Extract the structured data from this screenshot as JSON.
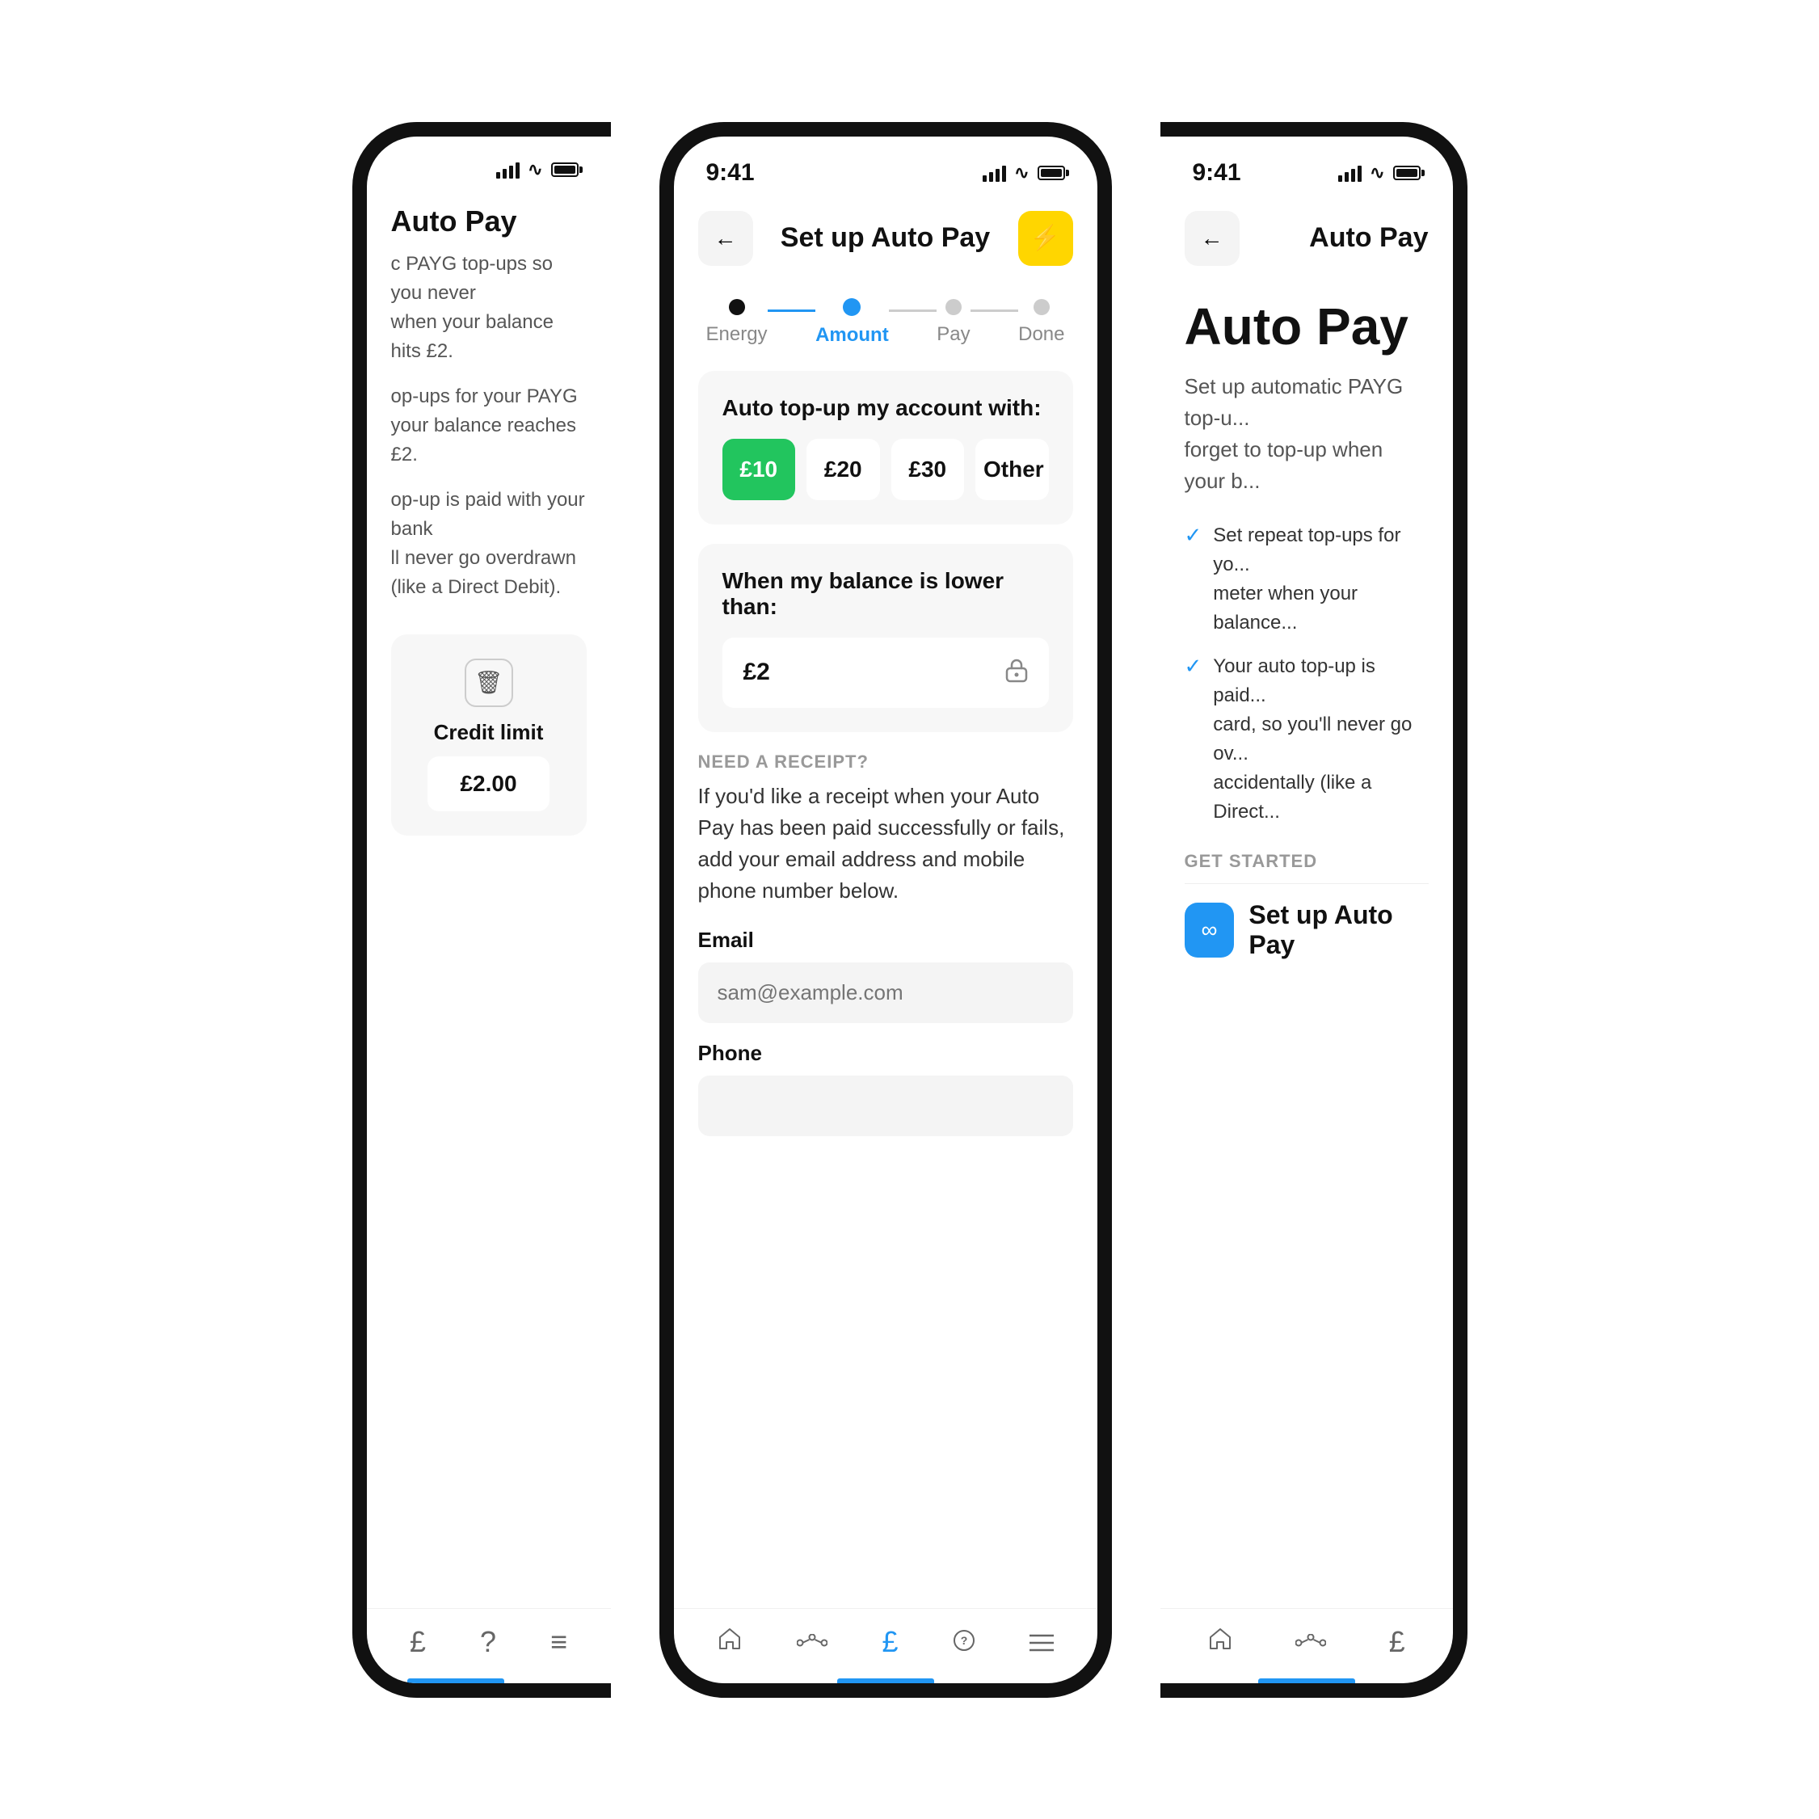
{
  "left_phone": {
    "title": "Auto Pay",
    "desc1": "c PAYG top-ups so you never\nwhen your balance hits £2.",
    "desc2": "op-ups for your PAYG\nyour balance reaches £2.",
    "desc3": "op-up is paid with your bank\nll never go overdrawn\n(like a Direct Debit).",
    "credit_limit_label": "Credit limit",
    "credit_amount": "£2.00",
    "bottom_nav": [
      "£",
      "?",
      "≡"
    ]
  },
  "center_phone": {
    "time": "9:41",
    "back_label": "←",
    "title": "Set up Auto Pay",
    "lightning": "⚡",
    "steps": [
      {
        "label": "Energy",
        "state": "completed"
      },
      {
        "label": "Amount",
        "state": "active"
      },
      {
        "label": "Pay",
        "state": "default"
      },
      {
        "label": "Done",
        "state": "default"
      }
    ],
    "topup_card": {
      "title": "Auto top-up my account with:",
      "options": [
        "£10",
        "£20",
        "£30",
        "Other"
      ],
      "selected": "£10"
    },
    "balance_card": {
      "title": "When my balance is lower than:",
      "value": "£2"
    },
    "receipt_section": {
      "label": "NEED A RECEIPT?",
      "text": "If you'd like a receipt when your Auto Pay has\nbeen paid successfully or fails, add your email\naddress and mobile phone number below.",
      "email_label": "Email",
      "email_placeholder": "sam@example.com",
      "phone_label": "Phone"
    },
    "bottom_nav": [
      "🏠",
      "⬡",
      "£",
      "?",
      "≡"
    ],
    "nav_active_index": 2
  },
  "right_phone": {
    "time": "9:41",
    "back_label": "←",
    "page_title": "Auto Pay",
    "nav_title": "Auto Pay",
    "hero_title": "Auto Pay",
    "desc": "Set up automatic PAYG top-u...\nforget to top-up when your b...",
    "check_items": [
      "Set repeat top-ups for yo...\nmeter when your balance...",
      "Your auto top-up is paid...\ncard, so you'll never go ov...\naccidentally (like a Direct..."
    ],
    "get_started_label": "GET STARTED",
    "setup_btn_label": "Set up Auto Pay",
    "bottom_nav": [
      "🏠",
      "⬡",
      "£"
    ]
  },
  "icons": {
    "back_arrow": "←",
    "lightning": "⚡",
    "lock": "🔒",
    "trash": "🗑",
    "infinity": "∞",
    "home": "⌂",
    "nodes": "◉",
    "pound": "£",
    "help": "?",
    "menu": "≡"
  },
  "colors": {
    "brand_blue": "#2196F3",
    "brand_green": "#22C55E",
    "brand_yellow": "#FFD600",
    "selected_bg": "#22C55E",
    "step_active": "#2196F3",
    "step_done": "#111111",
    "step_default": "#cccccc"
  }
}
